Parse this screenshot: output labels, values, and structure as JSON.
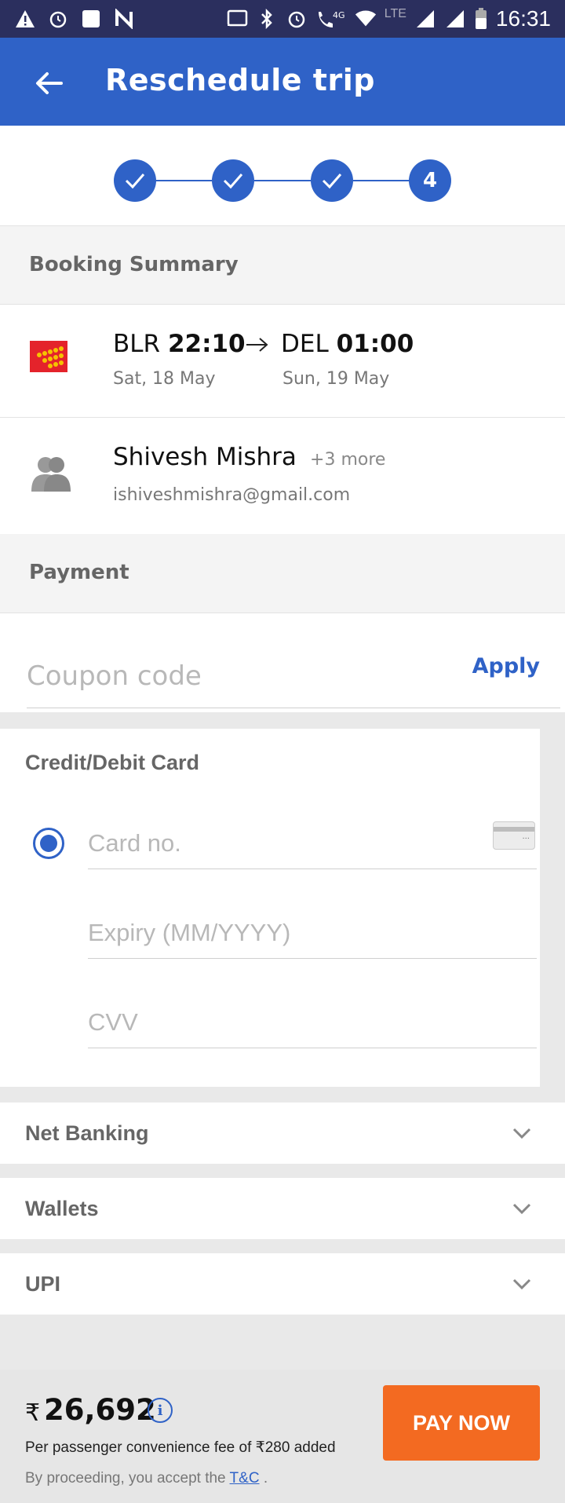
{
  "status_bar": {
    "time": "16:31",
    "network": "4G",
    "lte": "LTE",
    "icons": [
      "warning-icon",
      "alarm-icon",
      "square-icon",
      "n-icon",
      "cast-icon",
      "bluetooth-icon",
      "alarm-icon",
      "wifi-call-icon",
      "wifi-icon",
      "signal-icon",
      "signal-icon",
      "battery-icon"
    ]
  },
  "app_bar": {
    "title": "Reschedule trip"
  },
  "stepper": {
    "last_step": "4"
  },
  "booking_summary": {
    "title": "Booking Summary",
    "from_code": "BLR",
    "from_time": "22:10",
    "from_date": "Sat, 18 May",
    "to_code": "DEL",
    "to_time": "01:00",
    "to_date": "Sun, 19 May",
    "passenger_name": "Shivesh Mishra",
    "passenger_more": "+3 more",
    "passenger_email": "ishiveshmishra@gmail.com"
  },
  "payment": {
    "title": "Payment",
    "coupon_placeholder": "Coupon code",
    "apply_label": "Apply",
    "card_section_title": "Credit/Debit Card",
    "card_no_placeholder": "Card no.",
    "expiry_placeholder": "Expiry (MM/YYYY)",
    "cvv_placeholder": "CVV",
    "net_banking": "Net Banking",
    "wallets": "Wallets",
    "upi": "UPI"
  },
  "footer": {
    "currency": "₹",
    "amount": "26,692",
    "fee_text": "Per passenger convenience fee of ₹280 added",
    "terms_prefix": "By proceeding, you accept the ",
    "terms_link": "T&C",
    "terms_suffix": " .",
    "pay_label": "PAY NOW"
  },
  "colors": {
    "status_bar": "#2b2f5e",
    "primary": "#2f62c7",
    "pay_button": "#f36a21"
  }
}
